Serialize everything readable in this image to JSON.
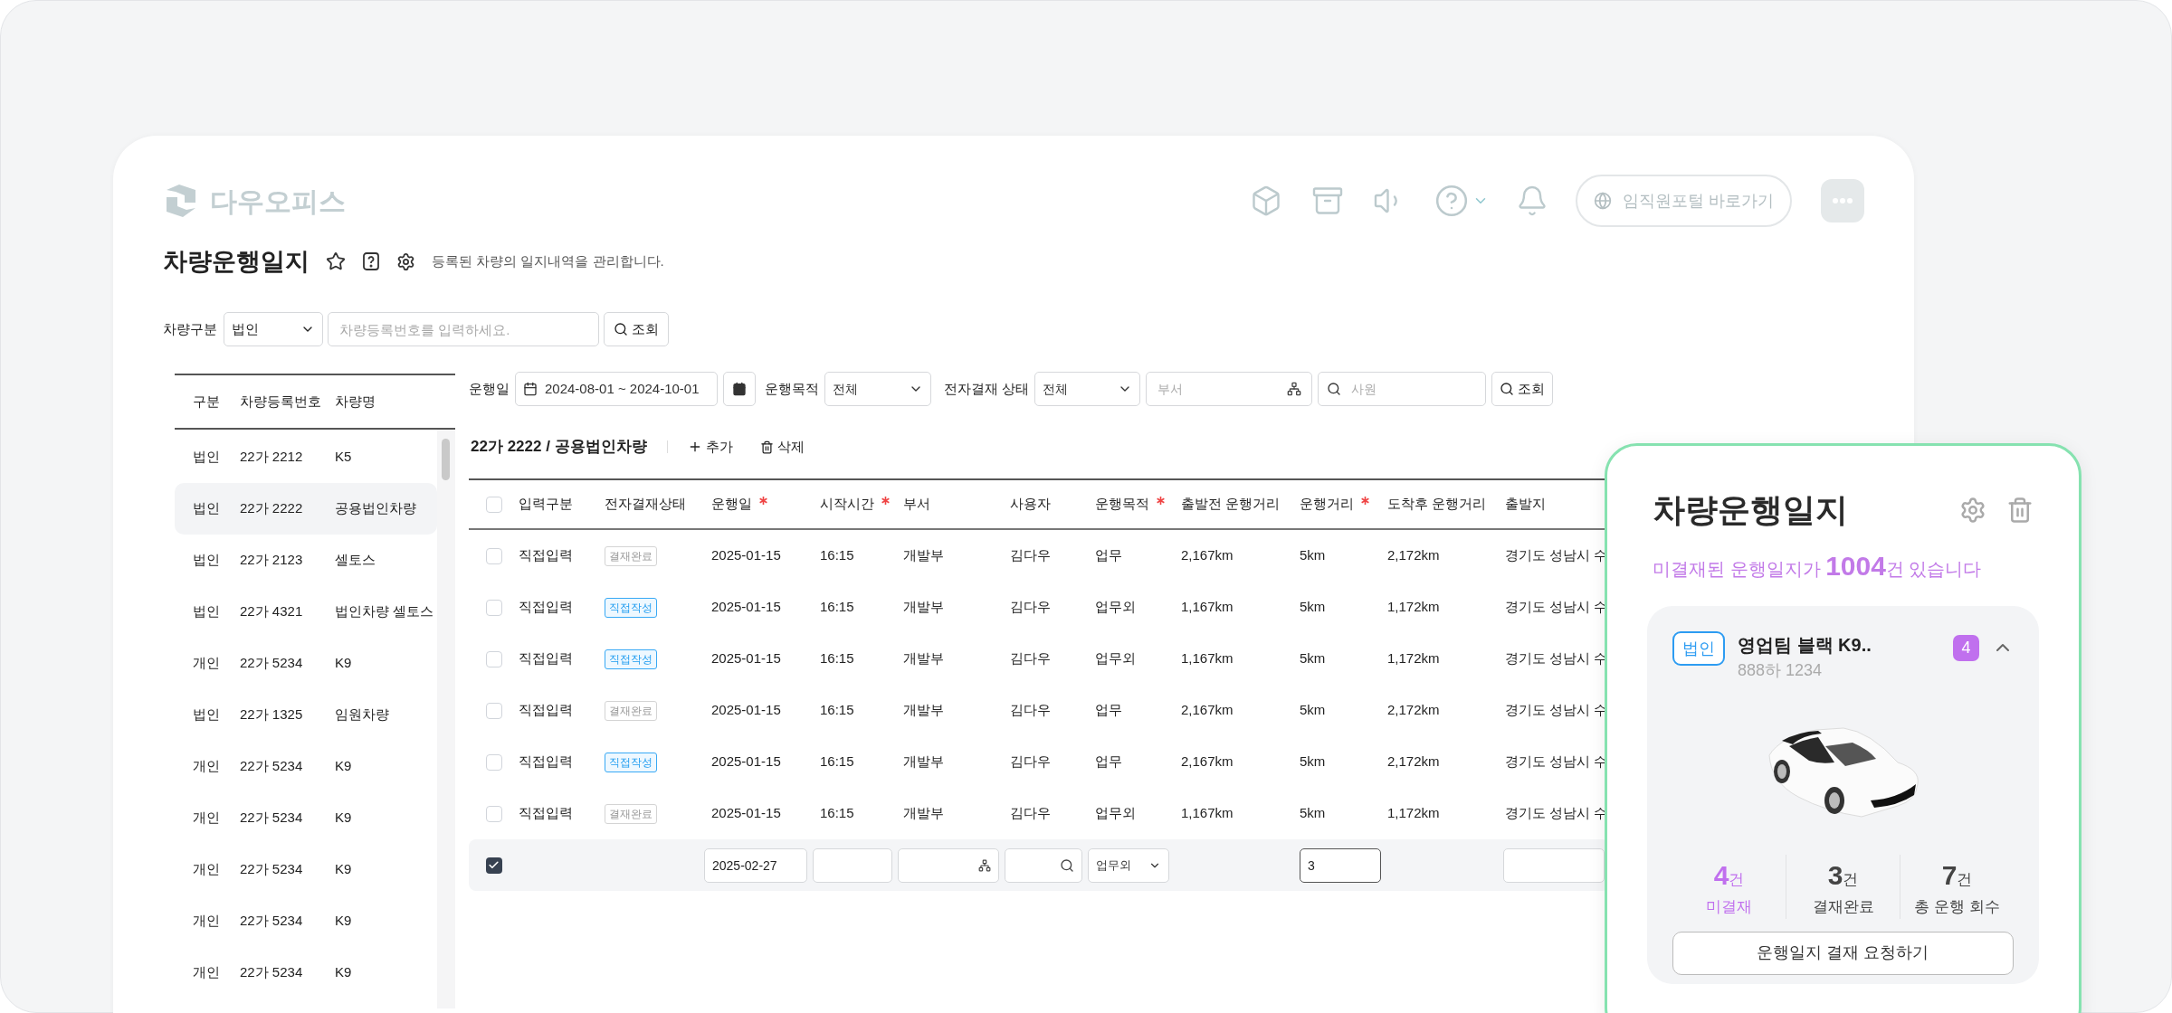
{
  "logo": {
    "text": "다우오피스"
  },
  "header_actions": {
    "portal_link": "임직원포털 바로가기"
  },
  "page": {
    "title": "차량운행일지",
    "description": "등록된 차량의 일지내역을 관리합니다."
  },
  "vehicle_filter": {
    "label": "차량구분",
    "type_value": "법인",
    "search_placeholder": "차량등록번호를 입력하세요.",
    "search_button": "조회"
  },
  "vehicle_list": {
    "columns": [
      "구분",
      "차량등록번호",
      "차량명"
    ],
    "rows": [
      {
        "type": "법인",
        "number": "22가 2212",
        "name": "K5",
        "selected": false
      },
      {
        "type": "법인",
        "number": "22가 2222",
        "name": "공용법인차량",
        "selected": true
      },
      {
        "type": "법인",
        "number": "22가 2123",
        "name": "셀토스",
        "selected": false
      },
      {
        "type": "법인",
        "number": "22가 4321",
        "name": "법인차량 셀토스",
        "selected": false
      },
      {
        "type": "개인",
        "number": "22가 5234",
        "name": "K9",
        "selected": false
      },
      {
        "type": "법인",
        "number": "22가 1325",
        "name": "임원차량",
        "selected": false
      },
      {
        "type": "개인",
        "number": "22가 5234",
        "name": "K9",
        "selected": false
      },
      {
        "type": "개인",
        "number": "22가 5234",
        "name": "K9",
        "selected": false
      },
      {
        "type": "개인",
        "number": "22가 5234",
        "name": "K9",
        "selected": false
      },
      {
        "type": "개인",
        "number": "22가 5234",
        "name": "K9",
        "selected": false
      },
      {
        "type": "개인",
        "number": "22가 5234",
        "name": "K9",
        "selected": false
      }
    ]
  },
  "log_filter": {
    "date_label": "운행일",
    "date_range": "2024-08-01 ~ 2024-10-01",
    "purpose_label": "운행목적",
    "purpose_value": "전체",
    "approval_label": "전자결재 상태",
    "approval_value": "전체",
    "department_placeholder": "부서",
    "employee_placeholder": "사원",
    "search_button": "조회"
  },
  "log_table": {
    "title": "22가 2222 / 공용법인차량",
    "add_button": "추가",
    "delete_button": "삭제",
    "all_checked": false,
    "columns": [
      {
        "label": "입력구분",
        "required": false
      },
      {
        "label": "전자결재상태",
        "required": false
      },
      {
        "label": "운행일",
        "required": true
      },
      {
        "label": "시작시간",
        "required": true
      },
      {
        "label": "부서",
        "required": false
      },
      {
        "label": "사용자",
        "required": false
      },
      {
        "label": "운행목적",
        "required": true
      },
      {
        "label": "출발전 운행거리",
        "required": false
      },
      {
        "label": "운행거리",
        "required": true
      },
      {
        "label": "도착후 운행거리",
        "required": false
      },
      {
        "label": "출발지",
        "required": false
      }
    ],
    "rows": [
      {
        "checked": false,
        "input_type": "직접입력",
        "approval": {
          "label": "결재완료",
          "kind": "done"
        },
        "date": "2025-01-15",
        "time": "16:15",
        "department": "개발부",
        "user": "김다우",
        "purpose": "업무",
        "before": "2,167km",
        "distance": "5km",
        "after": "2,172km",
        "origin": "경기도 성남시 수"
      },
      {
        "checked": false,
        "input_type": "직접입력",
        "approval": {
          "label": "직접작성",
          "kind": "draft"
        },
        "date": "2025-01-15",
        "time": "16:15",
        "department": "개발부",
        "user": "김다우",
        "purpose": "업무외",
        "before": "1,167km",
        "distance": "5km",
        "after": "1,172km",
        "origin": "경기도 성남시 수"
      },
      {
        "checked": false,
        "input_type": "직접입력",
        "approval": {
          "label": "직접작성",
          "kind": "draft"
        },
        "date": "2025-01-15",
        "time": "16:15",
        "department": "개발부",
        "user": "김다우",
        "purpose": "업무외",
        "before": "1,167km",
        "distance": "5km",
        "after": "1,172km",
        "origin": "경기도 성남시 수"
      },
      {
        "checked": false,
        "input_type": "직접입력",
        "approval": {
          "label": "결재완료",
          "kind": "done"
        },
        "date": "2025-01-15",
        "time": "16:15",
        "department": "개발부",
        "user": "김다우",
        "purpose": "업무",
        "before": "2,167km",
        "distance": "5km",
        "after": "2,172km",
        "origin": "경기도 성남시 수"
      },
      {
        "checked": false,
        "input_type": "직접입력",
        "approval": {
          "label": "직접작성",
          "kind": "draft"
        },
        "date": "2025-01-15",
        "time": "16:15",
        "department": "개발부",
        "user": "김다우",
        "purpose": "업무",
        "before": "2,167km",
        "distance": "5km",
        "after": "2,172km",
        "origin": "경기도 성남시 수"
      },
      {
        "checked": false,
        "input_type": "직접입력",
        "approval": {
          "label": "결재완료",
          "kind": "done"
        },
        "date": "2025-01-15",
        "time": "16:15",
        "department": "개발부",
        "user": "김다우",
        "purpose": "업무외",
        "before": "1,167km",
        "distance": "5km",
        "after": "1,172km",
        "origin": "경기도 성남시 수"
      }
    ],
    "new_row": {
      "checked": true,
      "date": "2025-02-27",
      "purpose": "업무외",
      "distance": "3"
    }
  },
  "summary_card": {
    "title": "차량운행일지",
    "message": "미결재된 운행일지가 **1004**건 있습니다",
    "vehicle": {
      "badge": "법인",
      "name": "영업팀 블랙 K9..",
      "plate": "888하 1234",
      "count": "4",
      "expanded": true
    },
    "stats": [
      {
        "value": "4",
        "unit": "건",
        "label": "미결재",
        "kind": "pending"
      },
      {
        "value": "3",
        "unit": "건",
        "label": "결재완료",
        "kind": "normal"
      },
      {
        "value": "7",
        "unit": "건",
        "label": "총 운행 회수",
        "kind": "normal"
      }
    ],
    "request_button": "운행일지 결재 요청하기"
  }
}
